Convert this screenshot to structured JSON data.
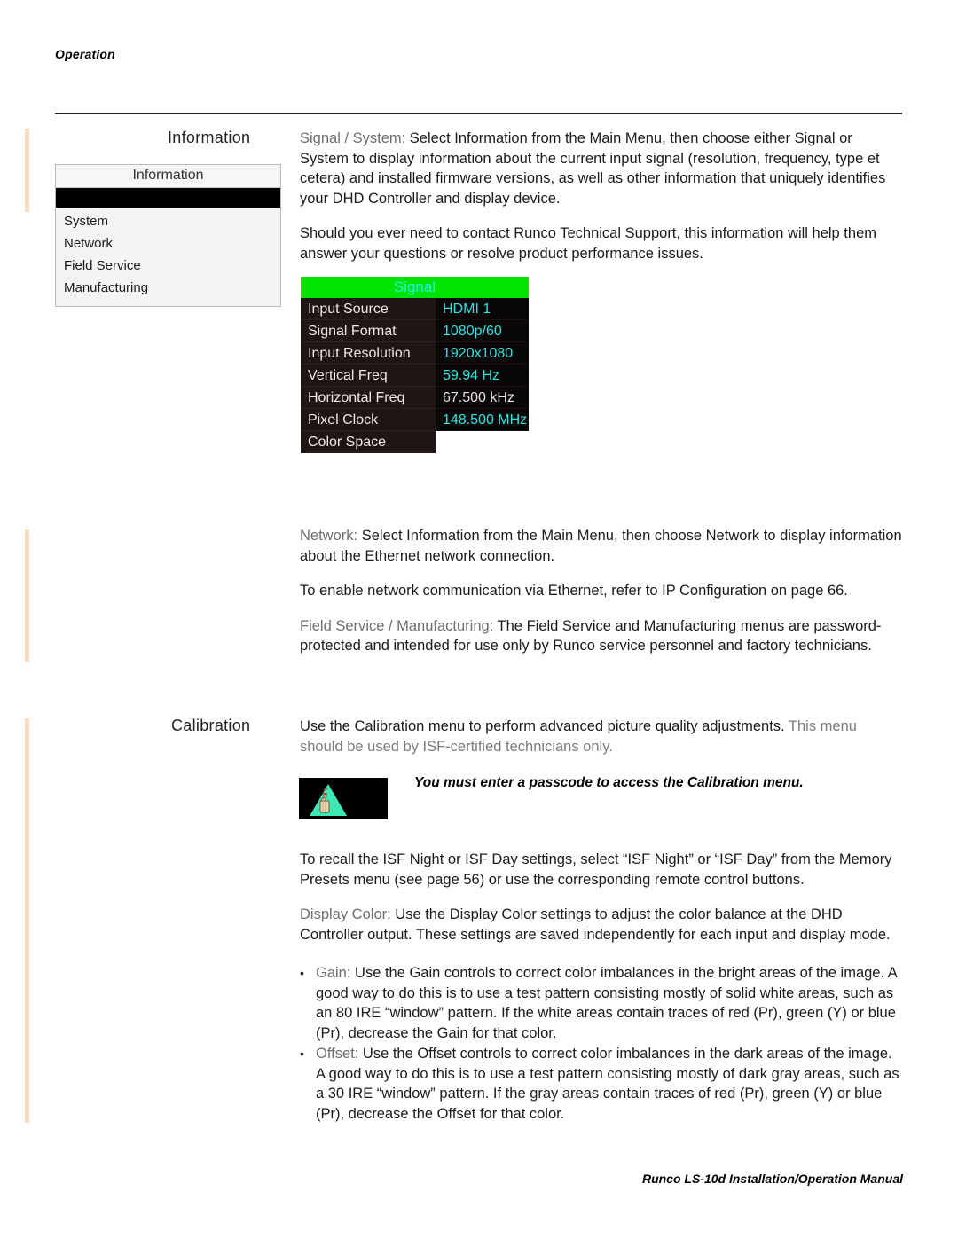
{
  "page": {
    "running_head": "Operation",
    "footer": "Runco LS-10d Installation/Operation Manual",
    "change_bar_color": "#fbdcbd"
  },
  "sections": {
    "information": {
      "label": "Information",
      "menu": {
        "title": "Information",
        "items": [
          {
            "label": "System"
          },
          {
            "label": "Network"
          },
          {
            "label": "Field Service"
          },
          {
            "label": "Manufacturing"
          }
        ]
      },
      "paragraphs": [
        {
          "lead": "Signal / System:",
          "body": " Select Information from the Main Menu, then choose either Signal or System to display information about the current input signal (resolution, frequency, type et cetera) and installed firmware versions, as well as other information that uniquely identifies your DHD Controller and display device."
        },
        {
          "lead": "",
          "body": "Should you ever need to contact Runco Technical Support, this information will help them answer your questions or resolve product performance issues."
        },
        {
          "lead": "Network:",
          "body": " Select Information from the Main Menu, then choose Network to display information about the Ethernet network connection."
        },
        {
          "lead": "",
          "body": "To enable network communication via Ethernet, refer to IP Configuration on page 66."
        },
        {
          "lead": "Field Service / Manufacturing:",
          "body": " The Field Service and Manufacturing menus are password-protected and intended for use only by Runco service personnel and factory technicians."
        }
      ]
    },
    "calibration": {
      "label": "Calibration",
      "intro_body": "Use the Calibration menu to perform advanced picture quality adjustments. ",
      "intro_faint": "This menu should be used by ISF-certified technicians only.",
      "note": "You must enter a passcode to access the Calibration menu.",
      "icon_name": "reminder-string-on-finger-icon",
      "paragraphs": [
        {
          "lead": "",
          "body": "To recall the ISF Night or ISF Day settings, select “ISF Night” or “ISF Day” from the Memory Presets menu (see page 56) or use the corresponding remote control buttons."
        },
        {
          "lead": "Display Color:",
          "body": " Use the Display Color settings to adjust the color balance at the DHD Controller output. These settings are saved independently for each input and display mode."
        }
      ],
      "bullets": [
        {
          "marker": "•",
          "lead": "Gain:",
          "body": " Use the Gain controls to correct color imbalances in the bright areas of the image. A good way to do this is to use a test pattern consisting mostly of solid white areas, such as an 80 IRE “window” pattern. If the white areas contain traces of red (Pr), green (Y) or blue (Pr), decrease the Gain for that color."
        },
        {
          "marker": "•",
          "lead": "Offset:",
          "body": " Use the Offset controls to correct color imbalances in the dark areas of the image. A good way to do this is to use a test pattern consisting mostly of dark gray areas, such as a 30 IRE “window” pattern. If the gray areas contain traces of red (Pr), green (Y) or blue (Pr), decrease the Offset for that color."
        }
      ]
    }
  },
  "osd": {
    "title": "Signal",
    "title_bg": "#00e400",
    "title_color": "#25f0e0",
    "rows": [
      {
        "key": "Input Source",
        "value": "HDMI 1",
        "value_style": "cyan"
      },
      {
        "key": "Signal Format",
        "value": "1080p/60",
        "value_style": "cyan"
      },
      {
        "key": "Input Resolution",
        "value": "1920x1080",
        "value_style": "cyan"
      },
      {
        "key": "Vertical Freq",
        "value": "59.94 Hz",
        "value_style": "cyan"
      },
      {
        "key": "Horizontal Freq",
        "value": "67.500 kHz",
        "value_style": "plain"
      },
      {
        "key": "Pixel Clock",
        "value": "148.500 MHz",
        "value_style": "cyan"
      },
      {
        "key": "Color Space",
        "value": "",
        "value_style": "empty"
      }
    ]
  }
}
